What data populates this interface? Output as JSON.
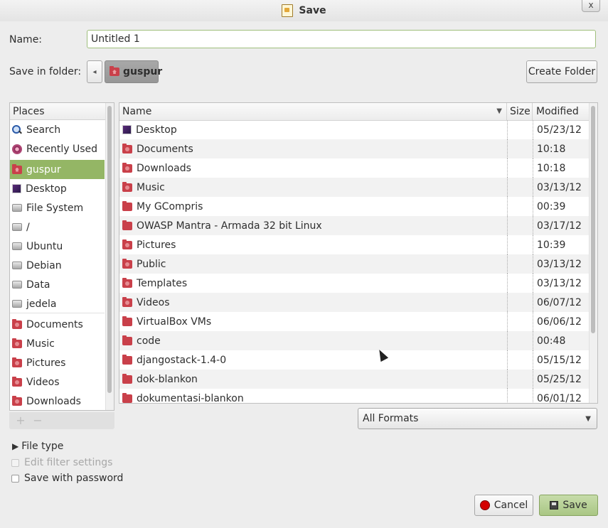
{
  "window": {
    "title": "Save",
    "close_glyph": "x",
    "app_icon": "document-icon"
  },
  "name_row": {
    "label": "Name:",
    "value": "Untitled 1"
  },
  "folder_row": {
    "label": "Save in folder:",
    "back_glyph": "◂",
    "current_folder": "guspur",
    "create_folder_label": "Create Folder"
  },
  "places": {
    "header": "Places",
    "items": [
      {
        "label": "Search",
        "icon": "search-icon",
        "selected": false
      },
      {
        "label": "Recently Used",
        "icon": "recent-icon",
        "selected": false
      },
      {
        "label": "guspur",
        "icon": "home-folder-icon",
        "selected": true
      },
      {
        "label": "Desktop",
        "icon": "desktop-icon",
        "selected": false
      },
      {
        "label": "File System",
        "icon": "drive-icon",
        "selected": false
      },
      {
        "label": "/",
        "icon": "drive-icon",
        "selected": false
      },
      {
        "label": "Ubuntu",
        "icon": "drive-icon",
        "selected": false
      },
      {
        "label": "Debian",
        "icon": "drive-icon",
        "selected": false
      },
      {
        "label": "Data",
        "icon": "drive-icon",
        "selected": false
      },
      {
        "label": "jedela",
        "icon": "drive-icon",
        "selected": false
      },
      {
        "label": "Documents",
        "icon": "folder-icon",
        "selected": false
      },
      {
        "label": "Music",
        "icon": "folder-icon",
        "selected": false
      },
      {
        "label": "Pictures",
        "icon": "folder-icon",
        "selected": false
      },
      {
        "label": "Videos",
        "icon": "folder-icon",
        "selected": false
      },
      {
        "label": "Downloads",
        "icon": "folder-icon",
        "selected": false
      }
    ],
    "add_glyph": "+",
    "remove_glyph": "−"
  },
  "files": {
    "columns": {
      "name": "Name",
      "size": "Size",
      "modified": "Modified",
      "sort_glyph": "▼"
    },
    "rows": [
      {
        "name": "Desktop",
        "size": "",
        "modified": "05/23/12",
        "icon": "desktop-icon"
      },
      {
        "name": "Documents",
        "size": "",
        "modified": "10:18",
        "icon": "folder-icon"
      },
      {
        "name": "Downloads",
        "size": "",
        "modified": "10:18",
        "icon": "folder-icon"
      },
      {
        "name": "Music",
        "size": "",
        "modified": "03/13/12",
        "icon": "folder-icon"
      },
      {
        "name": "My GCompris",
        "size": "",
        "modified": "00:39",
        "icon": "folder-icon"
      },
      {
        "name": "OWASP Mantra - Armada 32 bit Linux",
        "size": "",
        "modified": "03/17/12",
        "icon": "folder-icon"
      },
      {
        "name": "Pictures",
        "size": "",
        "modified": "10:39",
        "icon": "folder-icon"
      },
      {
        "name": "Public",
        "size": "",
        "modified": "03/13/12",
        "icon": "folder-icon"
      },
      {
        "name": "Templates",
        "size": "",
        "modified": "03/13/12",
        "icon": "folder-icon"
      },
      {
        "name": "Videos",
        "size": "",
        "modified": "06/07/12",
        "icon": "folder-icon"
      },
      {
        "name": "VirtualBox VMs",
        "size": "",
        "modified": "06/06/12",
        "icon": "folder-icon"
      },
      {
        "name": "code",
        "size": "",
        "modified": "00:48",
        "icon": "folder-icon"
      },
      {
        "name": "djangostack-1.4-0",
        "size": "",
        "modified": "05/15/12",
        "icon": "folder-icon"
      },
      {
        "name": "dok-blankon",
        "size": "",
        "modified": "05/25/12",
        "icon": "folder-icon"
      },
      {
        "name": "dokumentasi-blankon",
        "size": "",
        "modified": "06/01/12",
        "icon": "folder-icon"
      }
    ]
  },
  "filter": {
    "selected": "All Formats",
    "dropdown_glyph": "▼"
  },
  "options": {
    "file_type_label": "File type",
    "expander_glyph": "▶",
    "edit_filter_label": "Edit filter settings",
    "save_password_label": "Save with password"
  },
  "actions": {
    "cancel_label": "Cancel",
    "save_label": "Save"
  },
  "colors": {
    "selection": "#94b665",
    "folder": "#c9404a",
    "save_button": "#a9c684"
  }
}
